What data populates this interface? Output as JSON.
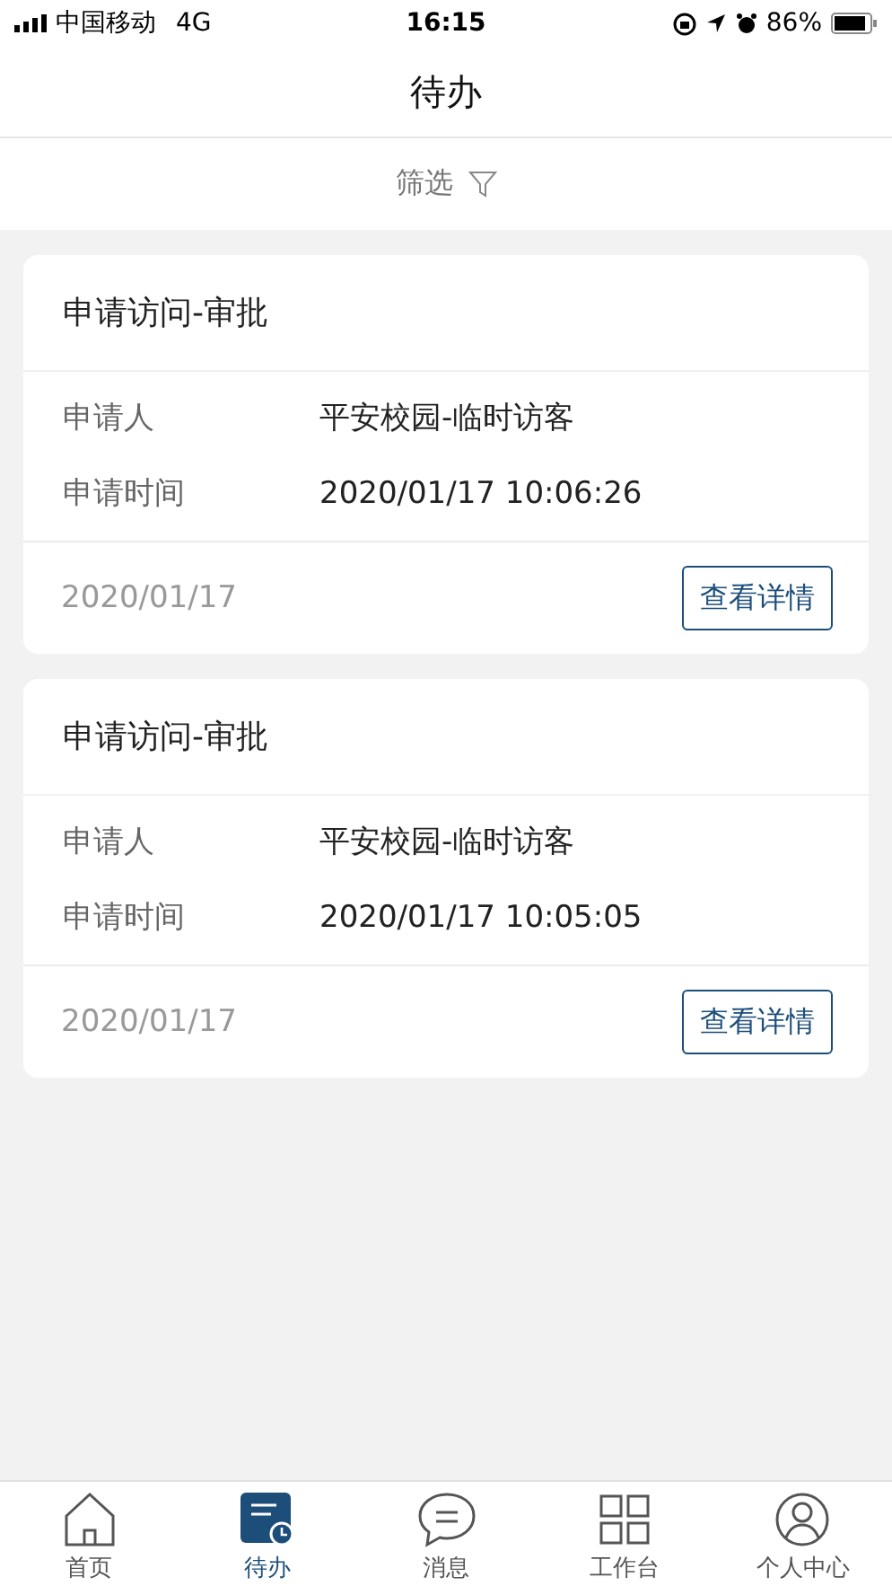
{
  "status_bar": {
    "carrier": "中国移动",
    "network": "4G",
    "time": "16:15",
    "battery": "86%"
  },
  "header": {
    "title": "待办"
  },
  "filter": {
    "label": "筛选"
  },
  "cards": [
    {
      "title": "申请访问-审批",
      "fields": [
        {
          "label": "申请人",
          "value": "平安校园-临时访客"
        },
        {
          "label": "申请时间",
          "value": "2020/01/17 10:06:26"
        }
      ],
      "date": "2020/01/17",
      "button": "查看详情"
    },
    {
      "title": "申请访问-审批",
      "fields": [
        {
          "label": "申请人",
          "value": "平安校园-临时访客"
        },
        {
          "label": "申请时间",
          "value": "2020/01/17 10:05:05"
        }
      ],
      "date": "2020/01/17",
      "button": "查看详情"
    }
  ],
  "tab_bar": [
    {
      "kind": "home",
      "label": "首页",
      "selected": false
    },
    {
      "kind": "todo",
      "label": "待办",
      "selected": true
    },
    {
      "kind": "message",
      "label": "消息",
      "selected": false
    },
    {
      "kind": "workbench",
      "label": "工作台",
      "selected": false
    },
    {
      "kind": "profile",
      "label": "个人中心",
      "selected": false
    }
  ]
}
